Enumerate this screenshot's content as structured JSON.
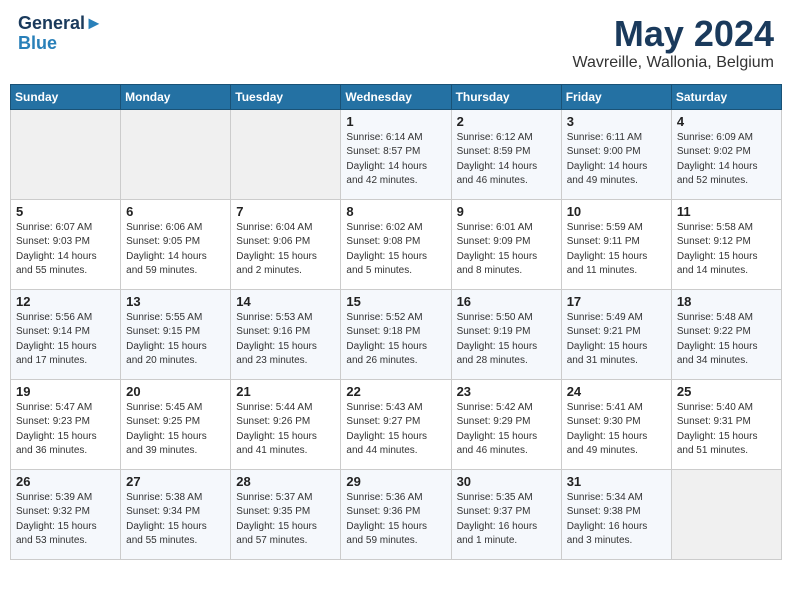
{
  "header": {
    "logo_line1": "General",
    "logo_line2": "Blue",
    "month_year": "May 2024",
    "location": "Wavreille, Wallonia, Belgium"
  },
  "weekdays": [
    "Sunday",
    "Monday",
    "Tuesday",
    "Wednesday",
    "Thursday",
    "Friday",
    "Saturday"
  ],
  "weeks": [
    [
      {
        "day": "",
        "sunrise": "",
        "sunset": "",
        "daylight": "",
        "empty": true
      },
      {
        "day": "",
        "sunrise": "",
        "sunset": "",
        "daylight": "",
        "empty": true
      },
      {
        "day": "",
        "sunrise": "",
        "sunset": "",
        "daylight": "",
        "empty": true
      },
      {
        "day": "1",
        "sunrise": "Sunrise: 6:14 AM",
        "sunset": "Sunset: 8:57 PM",
        "daylight": "Daylight: 14 hours and 42 minutes."
      },
      {
        "day": "2",
        "sunrise": "Sunrise: 6:12 AM",
        "sunset": "Sunset: 8:59 PM",
        "daylight": "Daylight: 14 hours and 46 minutes."
      },
      {
        "day": "3",
        "sunrise": "Sunrise: 6:11 AM",
        "sunset": "Sunset: 9:00 PM",
        "daylight": "Daylight: 14 hours and 49 minutes."
      },
      {
        "day": "4",
        "sunrise": "Sunrise: 6:09 AM",
        "sunset": "Sunset: 9:02 PM",
        "daylight": "Daylight: 14 hours and 52 minutes."
      }
    ],
    [
      {
        "day": "5",
        "sunrise": "Sunrise: 6:07 AM",
        "sunset": "Sunset: 9:03 PM",
        "daylight": "Daylight: 14 hours and 55 minutes."
      },
      {
        "day": "6",
        "sunrise": "Sunrise: 6:06 AM",
        "sunset": "Sunset: 9:05 PM",
        "daylight": "Daylight: 14 hours and 59 minutes."
      },
      {
        "day": "7",
        "sunrise": "Sunrise: 6:04 AM",
        "sunset": "Sunset: 9:06 PM",
        "daylight": "Daylight: 15 hours and 2 minutes."
      },
      {
        "day": "8",
        "sunrise": "Sunrise: 6:02 AM",
        "sunset": "Sunset: 9:08 PM",
        "daylight": "Daylight: 15 hours and 5 minutes."
      },
      {
        "day": "9",
        "sunrise": "Sunrise: 6:01 AM",
        "sunset": "Sunset: 9:09 PM",
        "daylight": "Daylight: 15 hours and 8 minutes."
      },
      {
        "day": "10",
        "sunrise": "Sunrise: 5:59 AM",
        "sunset": "Sunset: 9:11 PM",
        "daylight": "Daylight: 15 hours and 11 minutes."
      },
      {
        "day": "11",
        "sunrise": "Sunrise: 5:58 AM",
        "sunset": "Sunset: 9:12 PM",
        "daylight": "Daylight: 15 hours and 14 minutes."
      }
    ],
    [
      {
        "day": "12",
        "sunrise": "Sunrise: 5:56 AM",
        "sunset": "Sunset: 9:14 PM",
        "daylight": "Daylight: 15 hours and 17 minutes."
      },
      {
        "day": "13",
        "sunrise": "Sunrise: 5:55 AM",
        "sunset": "Sunset: 9:15 PM",
        "daylight": "Daylight: 15 hours and 20 minutes."
      },
      {
        "day": "14",
        "sunrise": "Sunrise: 5:53 AM",
        "sunset": "Sunset: 9:16 PM",
        "daylight": "Daylight: 15 hours and 23 minutes."
      },
      {
        "day": "15",
        "sunrise": "Sunrise: 5:52 AM",
        "sunset": "Sunset: 9:18 PM",
        "daylight": "Daylight: 15 hours and 26 minutes."
      },
      {
        "day": "16",
        "sunrise": "Sunrise: 5:50 AM",
        "sunset": "Sunset: 9:19 PM",
        "daylight": "Daylight: 15 hours and 28 minutes."
      },
      {
        "day": "17",
        "sunrise": "Sunrise: 5:49 AM",
        "sunset": "Sunset: 9:21 PM",
        "daylight": "Daylight: 15 hours and 31 minutes."
      },
      {
        "day": "18",
        "sunrise": "Sunrise: 5:48 AM",
        "sunset": "Sunset: 9:22 PM",
        "daylight": "Daylight: 15 hours and 34 minutes."
      }
    ],
    [
      {
        "day": "19",
        "sunrise": "Sunrise: 5:47 AM",
        "sunset": "Sunset: 9:23 PM",
        "daylight": "Daylight: 15 hours and 36 minutes."
      },
      {
        "day": "20",
        "sunrise": "Sunrise: 5:45 AM",
        "sunset": "Sunset: 9:25 PM",
        "daylight": "Daylight: 15 hours and 39 minutes."
      },
      {
        "day": "21",
        "sunrise": "Sunrise: 5:44 AM",
        "sunset": "Sunset: 9:26 PM",
        "daylight": "Daylight: 15 hours and 41 minutes."
      },
      {
        "day": "22",
        "sunrise": "Sunrise: 5:43 AM",
        "sunset": "Sunset: 9:27 PM",
        "daylight": "Daylight: 15 hours and 44 minutes."
      },
      {
        "day": "23",
        "sunrise": "Sunrise: 5:42 AM",
        "sunset": "Sunset: 9:29 PM",
        "daylight": "Daylight: 15 hours and 46 minutes."
      },
      {
        "day": "24",
        "sunrise": "Sunrise: 5:41 AM",
        "sunset": "Sunset: 9:30 PM",
        "daylight": "Daylight: 15 hours and 49 minutes."
      },
      {
        "day": "25",
        "sunrise": "Sunrise: 5:40 AM",
        "sunset": "Sunset: 9:31 PM",
        "daylight": "Daylight: 15 hours and 51 minutes."
      }
    ],
    [
      {
        "day": "26",
        "sunrise": "Sunrise: 5:39 AM",
        "sunset": "Sunset: 9:32 PM",
        "daylight": "Daylight: 15 hours and 53 minutes."
      },
      {
        "day": "27",
        "sunrise": "Sunrise: 5:38 AM",
        "sunset": "Sunset: 9:34 PM",
        "daylight": "Daylight: 15 hours and 55 minutes."
      },
      {
        "day": "28",
        "sunrise": "Sunrise: 5:37 AM",
        "sunset": "Sunset: 9:35 PM",
        "daylight": "Daylight: 15 hours and 57 minutes."
      },
      {
        "day": "29",
        "sunrise": "Sunrise: 5:36 AM",
        "sunset": "Sunset: 9:36 PM",
        "daylight": "Daylight: 15 hours and 59 minutes."
      },
      {
        "day": "30",
        "sunrise": "Sunrise: 5:35 AM",
        "sunset": "Sunset: 9:37 PM",
        "daylight": "Daylight: 16 hours and 1 minute."
      },
      {
        "day": "31",
        "sunrise": "Sunrise: 5:34 AM",
        "sunset": "Sunset: 9:38 PM",
        "daylight": "Daylight: 16 hours and 3 minutes."
      },
      {
        "day": "",
        "sunrise": "",
        "sunset": "",
        "daylight": "",
        "empty": true
      }
    ]
  ]
}
